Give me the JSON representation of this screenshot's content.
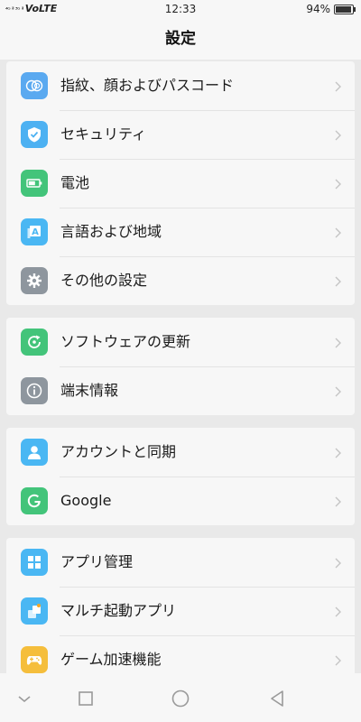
{
  "status_bar": {
    "signal_text": "⁴ᴳ ⁱˡˡ ³ᴳ ⁱˡˡ",
    "network": "VoLTE",
    "time": "12:33",
    "battery": "94%",
    "battery_level": 0.94
  },
  "header": {
    "title": "設定"
  },
  "groups": [
    {
      "items": [
        {
          "label": "指紋、顔およびパスコード",
          "icon": "fingerprint-icon",
          "color": "#5aa9f0"
        },
        {
          "label": "セキュリティ",
          "icon": "shield-icon",
          "color": "#4db1f2"
        },
        {
          "label": "電池",
          "icon": "battery-icon",
          "color": "#43c47a"
        },
        {
          "label": "言語および地域",
          "icon": "language-icon",
          "color": "#4ab7f3"
        },
        {
          "label": "その他の設定",
          "icon": "gear-icon",
          "color": "#8e969e"
        }
      ]
    },
    {
      "items": [
        {
          "label": "ソフトウェアの更新",
          "icon": "update-icon",
          "color": "#43c47a"
        },
        {
          "label": "端末情報",
          "icon": "info-icon",
          "color": "#8e969e"
        }
      ]
    },
    {
      "items": [
        {
          "label": "アカウントと同期",
          "icon": "account-icon",
          "color": "#4ab7f3"
        },
        {
          "label": "Google",
          "icon": "google-icon",
          "color": "#43c47a"
        }
      ]
    },
    {
      "items": [
        {
          "label": "アプリ管理",
          "icon": "apps-icon",
          "color": "#4ab7f3"
        },
        {
          "label": "マルチ起動アプリ",
          "icon": "clone-app-icon",
          "color": "#4ab7f3"
        },
        {
          "label": "ゲーム加速機能",
          "icon": "game-icon",
          "color": "#f5be3c"
        }
      ]
    }
  ],
  "nav_bar": {
    "icons": [
      "chevron-down-icon",
      "recent-apps-icon",
      "home-icon",
      "back-icon"
    ]
  }
}
